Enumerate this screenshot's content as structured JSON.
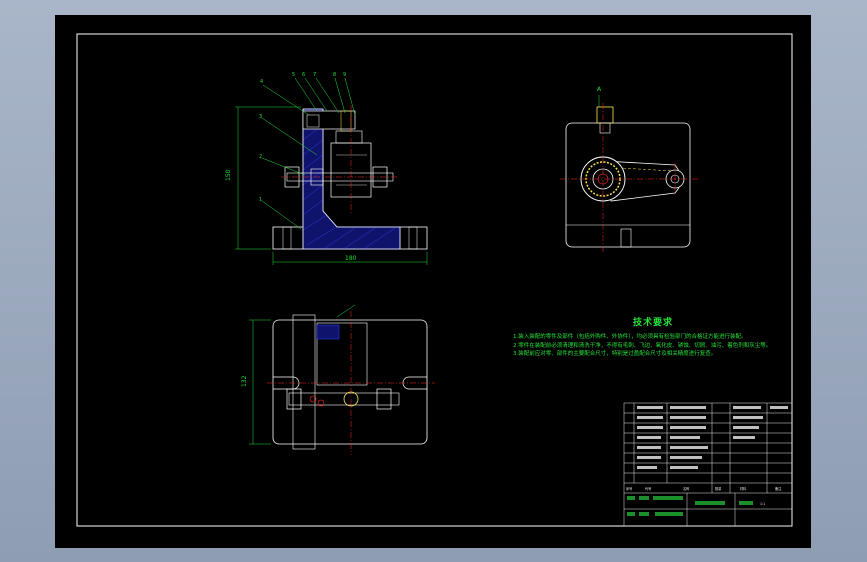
{
  "drawing": {
    "view_label": "A",
    "dim_width": "180",
    "dim_height": "150",
    "dim_height_plan": "132",
    "balloons": [
      "1",
      "2",
      "3",
      "4",
      "5",
      "6",
      "7",
      "8",
      "9"
    ]
  },
  "technical_requirements": {
    "title": "技术要求",
    "lines": [
      "1.装入装配的零件及部件（包括外购件、外协件），均必须具有检验部门的合格证方能进行装配。",
      "2.零件在装配前必须清理和清洗干净，不得有毛刺、飞边、氧化皮、锈蚀、切屑、油污、着色剂和灰尘等。",
      "3.装配前应对零、部件的主要配合尺寸，特别是过盈配合尺寸及相关精度进行复查。"
    ]
  },
  "title_block": {
    "header_labels": [
      "序号",
      "代号",
      "名称",
      "数量",
      "材料",
      "备注"
    ],
    "scale": "1:1"
  },
  "colors": {
    "background": "#000000",
    "outline": "#ffffff",
    "centerline": "#ff2a2a",
    "dimension": "#22e03a",
    "hidden": "#ffe54a",
    "hatch": "#3b46ff",
    "balloon": "#22e03a"
  }
}
